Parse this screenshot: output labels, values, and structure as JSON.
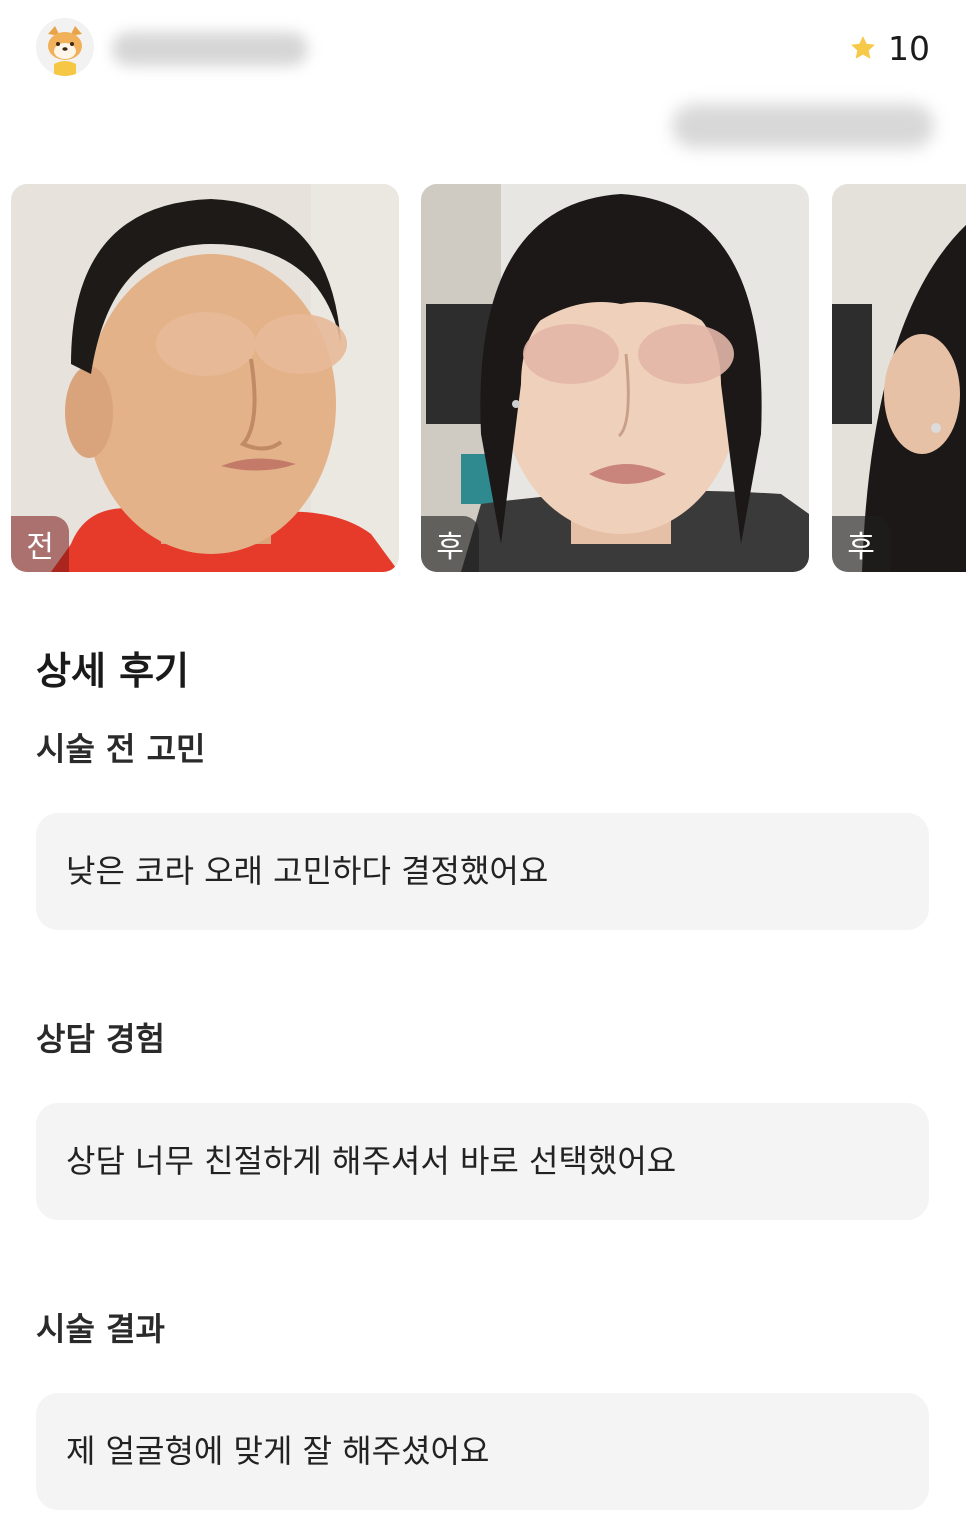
{
  "header": {
    "avatar_icon": "shiba-dog-avatar-icon",
    "rating_icon": "star-icon",
    "rating_color": "#f7c948",
    "rating_value": "10"
  },
  "photos": [
    {
      "badge": "전"
    },
    {
      "badge": "후"
    },
    {
      "badge": "후"
    }
  ],
  "review": {
    "section_title": "상세 후기",
    "items": [
      {
        "question": "시술 전 고민",
        "answer": "낮은 코라 오래 고민하다 결정했어요"
      },
      {
        "question": "상담 경험",
        "answer": "상담 너무 친절하게 해주셔서 바로 선택했어요"
      },
      {
        "question": "시술 결과",
        "answer": "제 얼굴형에 맞게 잘 해주셨어요"
      }
    ]
  },
  "colors": {
    "answer_background": "#f4f4f4",
    "badge_background": "#333333"
  }
}
